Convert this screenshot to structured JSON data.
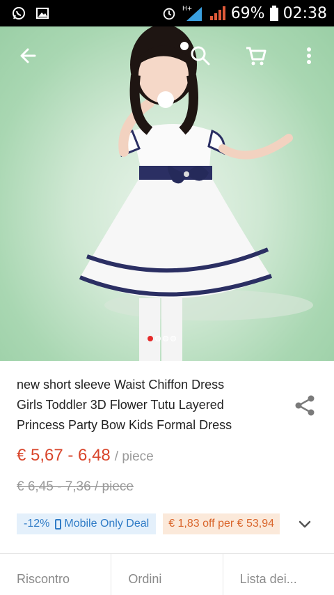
{
  "status_bar": {
    "battery": "69%",
    "time": "02:38",
    "network": "H+"
  },
  "app_bar": {
    "icons": [
      "back-arrow-icon",
      "search-icon",
      "cart-icon",
      "more-vert-icon"
    ]
  },
  "gallery": {
    "image": "girl in white chiffon tutu dress with navy ribbon",
    "pages": 4,
    "active_page": 1
  },
  "product": {
    "title_lines": [
      "new short sleeve  Waist Chiffon Dress",
      "Girls Toddler 3D Flower Tutu Layered",
      "Princess Party Bow Kids Formal Dress"
    ],
    "price": "€ 5,67 - 6,48",
    "price_unit": "/ piece",
    "old_price": "€ 6,45 - 7,36 / piece",
    "discount_badge": "-12%",
    "mobile_deal": "Mobile Only Deal",
    "coupon": "€ 1,83 off per € 53,94"
  },
  "tabs": [
    "Riscontro",
    "Ordini",
    "Lista dei..."
  ],
  "colors": {
    "price": "#d9452b",
    "accent_blue": "#2f7bc6",
    "coupon_orange": "#d9652b",
    "active_dot": "#e52b2b"
  }
}
